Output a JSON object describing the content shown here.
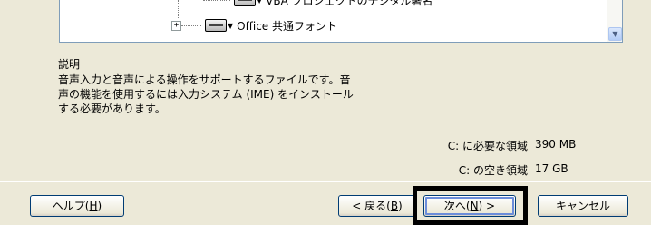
{
  "tree": {
    "items": [
      {
        "label": "VBA プロジェクトのデジタル署名",
        "expander": ""
      },
      {
        "label": "Office 共通フォント",
        "expander": "+"
      }
    ]
  },
  "description": {
    "heading": "説明",
    "lines": [
      "音声入力と音声による操作をサポートするファイルです。音",
      "声の機能を使用するには入力システム (IME) をインストール",
      "する必要があります。"
    ]
  },
  "space": {
    "required_label": "C: に必要な領域",
    "required_value": "390 MB",
    "free_label": "C: の空き領域",
    "free_value": "17 GB"
  },
  "buttons": {
    "help": {
      "text": "ヘルプ(",
      "key": "H",
      "end": ")"
    },
    "back": {
      "text": "< 戻る(",
      "key": "B",
      "end": ")"
    },
    "next": {
      "text": "次へ(",
      "key": "N",
      "end": ") >"
    },
    "cancel": "キャンセル"
  }
}
